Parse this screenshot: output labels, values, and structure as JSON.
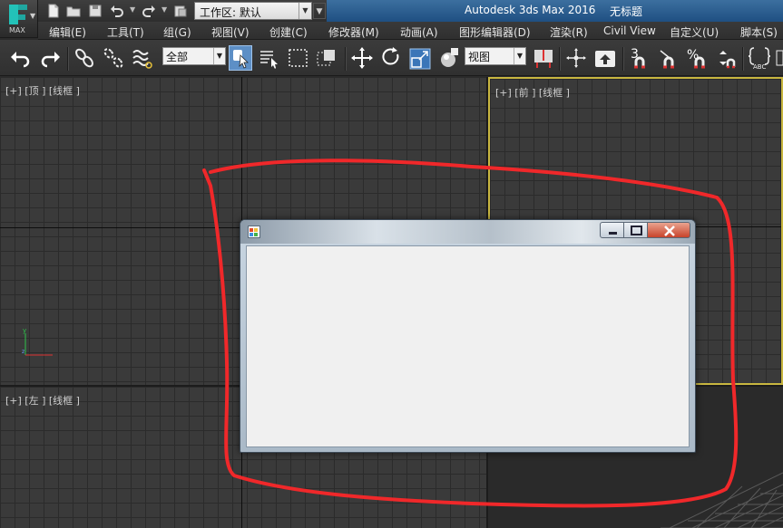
{
  "window": {
    "app_title": "Autodesk 3ds Max 2016",
    "doc_title": "无标题",
    "logo_text": "MAX",
    "workspace_label": "工作区: 默认"
  },
  "quick_access": {
    "icons": [
      "new-file-icon",
      "open-file-icon",
      "save-icon",
      "undo-icon",
      "redo-icon",
      "project-folder-icon"
    ]
  },
  "menu": {
    "items": [
      "编辑(E)",
      "工具(T)",
      "组(G)",
      "视图(V)",
      "创建(C)",
      "修改器(M)",
      "动画(A)",
      "图形编辑器(D)",
      "渲染(R)",
      "Civil View",
      "自定义(U)",
      "脚本(S)"
    ]
  },
  "toolbar": {
    "selection_filter": "全部",
    "reference_coord": "视图",
    "snap_label": "3",
    "angle_snap_label": "%"
  },
  "viewports": {
    "top": {
      "label": "[+] [顶 ] [线框 ]"
    },
    "front": {
      "label": "[+] [前 ] [线框 ]"
    },
    "left": {
      "label": "[+] [左 ] [线框 ]"
    }
  },
  "colors": {
    "title_blue": "#2a5d91",
    "annotation_red": "#f0282a",
    "active_viewport_border": "#c8b640",
    "tool_selected": "#5d8fc6"
  },
  "form_window": {
    "title": ""
  }
}
